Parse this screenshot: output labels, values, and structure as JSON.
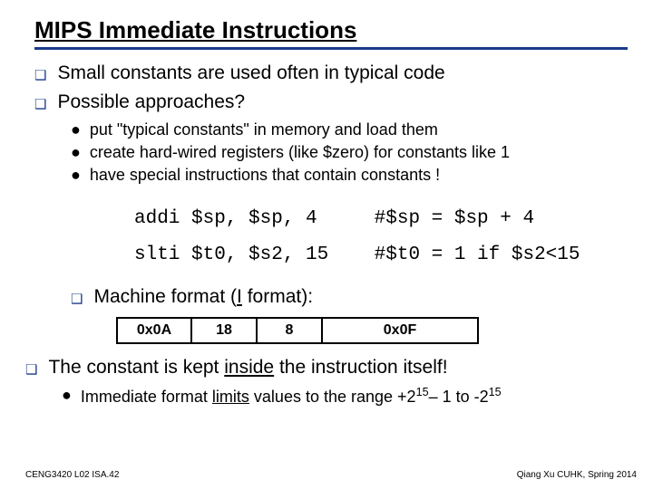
{
  "title": "MIPS Immediate Instructions",
  "bullets": {
    "b1": "Small constants are used often in typical code",
    "b2": "Possible approaches?",
    "sub1": "put \"typical constants\" in memory and load them",
    "sub2": "create hard-wired registers (like $zero) for constants like 1",
    "sub3": "have special instructions that contain constants !"
  },
  "code": {
    "line1": "addi $sp, $sp, 4     #$sp = $sp + 4",
    "line2": "slti $t0, $s2, 15    #$t0 = 1 if $s2<15"
  },
  "machine_fmt": {
    "label_pre": "Machine format (",
    "label_i": "I",
    "label_post": " format):",
    "cells": [
      "0x0A",
      "18",
      "8",
      "0x0F"
    ]
  },
  "bottom": {
    "b3_pre": "The constant is kept ",
    "b3_in": "inside",
    "b3_post": " the instruction itself!",
    "sub4_pre": "Immediate format ",
    "sub4_lim": "limits",
    "sub4_mid": " values to the range +2",
    "sub4_exp1": "15",
    "sub4_mid2": "– 1 to -2",
    "sub4_exp2": "15"
  },
  "footer": {
    "left": "CENG3420 L02 ISA.42",
    "right": "Qiang Xu   CUHK, Spring 2014"
  }
}
